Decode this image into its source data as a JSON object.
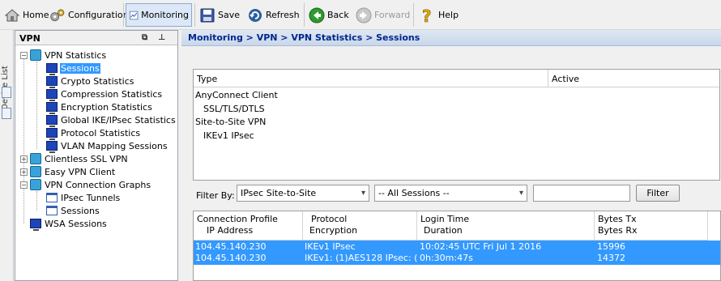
{
  "toolbar": {
    "home": "Home",
    "configuration": "Configuration",
    "monitoring": "Monitoring",
    "save": "Save",
    "refresh": "Refresh",
    "back": "Back",
    "forward": "Forward",
    "help": "Help"
  },
  "device_list": {
    "label": "Device List"
  },
  "vpn_panel": {
    "title": "VPN",
    "tree": {
      "vpn_statistics": "VPN Statistics",
      "sessions": "Sessions",
      "crypto": "Crypto Statistics",
      "compression": "Compression Statistics",
      "encryption": "Encryption Statistics",
      "global_ike": "Global IKE/IPsec Statistics",
      "protocol": "Protocol Statistics",
      "vlan_mapping": "VLAN Mapping Sessions",
      "clientless": "Clientless SSL VPN",
      "easy_vpn": "Easy VPN Client",
      "connection_graphs": "VPN Connection Graphs",
      "ipsec_tunnels": "IPsec Tunnels",
      "graph_sessions": "Sessions",
      "wsa": "WSA Sessions"
    }
  },
  "breadcrumb": {
    "path": "Monitoring > VPN > VPN Statistics > ",
    "current": "Sessions"
  },
  "type_table": {
    "col_type": "Type",
    "col_active": "Active",
    "rows": [
      "AnyConnect Client",
      "SSL/TLS/DTLS",
      "Site-to-Site VPN",
      "IKEv1 IPsec"
    ]
  },
  "filter": {
    "label": "Filter By:",
    "filter_by_value": "IPsec Site-to-Site",
    "sessions_value": "-- All Sessions --",
    "search_value": "",
    "button": "Filter"
  },
  "sessions_table": {
    "headers": {
      "profile": "Connection Profile",
      "ip": "IP Address",
      "protocol": "Protocol",
      "encryption": "Encryption",
      "login_time": "Login Time",
      "duration": "Duration",
      "bytes_tx": "Bytes Tx",
      "bytes_rx": "Bytes Rx"
    },
    "row": {
      "profile": "104.45.140.230",
      "ip": "104.45.140.230",
      "protocol": "IKEv1 IPsec",
      "encryption": "IKEv1: (1)AES128  IPsec: (…",
      "login_time": "10:02:45 UTC Fri Jul 1 2016",
      "duration": "0h:30m:47s",
      "bytes_tx": "15996",
      "bytes_rx": "14372"
    }
  }
}
